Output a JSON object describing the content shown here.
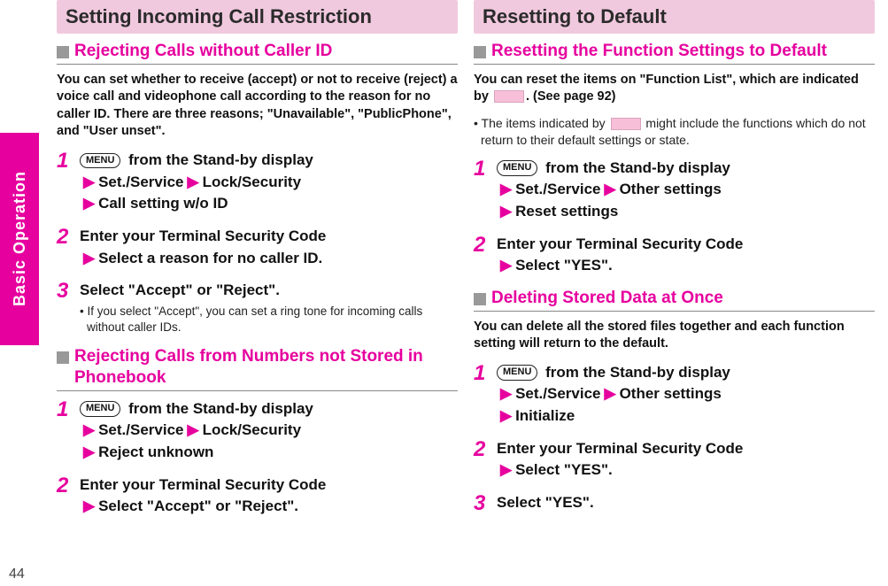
{
  "page": {
    "number": "44",
    "side_tab": "Basic Operation"
  },
  "left": {
    "section_title": "Setting Incoming Call Restriction",
    "sub1": {
      "title": "Rejecting Calls without Caller ID",
      "intro": "You can set whether to receive (accept) or not to receive (reject) a voice call and videophone call according to the reason for no caller ID. There are three reasons; \"Unavailable\", \"PublicPhone\", and \"User unset\".",
      "steps": [
        {
          "n": "1",
          "menu": "MENU",
          "after_menu": " from the Stand-by display",
          "lines": [
            "Set./Service",
            "Lock/Security",
            "Call setting w/o ID"
          ]
        },
        {
          "n": "2",
          "plain": "Enter your Terminal Security Code",
          "lines": [
            "Select a reason for no caller ID."
          ]
        },
        {
          "n": "3",
          "plain": "Select \"Accept\" or \"Reject\".",
          "note": "If you select \"Accept\", you can set a ring tone for incoming calls without caller IDs."
        }
      ]
    },
    "sub2": {
      "title": "Rejecting Calls from Numbers not Stored in Phonebook",
      "steps": [
        {
          "n": "1",
          "menu": "MENU",
          "after_menu": " from the Stand-by display",
          "lines": [
            "Set./Service",
            "Lock/Security",
            "Reject unknown"
          ]
        },
        {
          "n": "2",
          "plain": "Enter your Terminal Security Code",
          "lines": [
            "Select \"Accept\" or \"Reject\"."
          ]
        }
      ]
    }
  },
  "right": {
    "section_title": "Resetting to Default",
    "sub1": {
      "title": "Resetting the Function Settings to Default",
      "intro_pre": "You can reset the items on \"Function List\", which are indicated by ",
      "intro_post": ". (See page 92)",
      "note_pre": "The items indicated by ",
      "note_post": " might include the functions which do not return to their default settings or state.",
      "steps": [
        {
          "n": "1",
          "menu": "MENU",
          "after_menu": " from the Stand-by display",
          "lines": [
            "Set./Service",
            "Other settings",
            "Reset settings"
          ]
        },
        {
          "n": "2",
          "plain": "Enter your Terminal Security Code",
          "lines": [
            "Select \"YES\"."
          ]
        }
      ]
    },
    "sub2": {
      "title": "Deleting Stored Data at Once",
      "intro": "You can delete all the stored files together and each function setting will return to the default.",
      "steps": [
        {
          "n": "1",
          "menu": "MENU",
          "after_menu": " from the Stand-by display",
          "lines": [
            "Set./Service",
            "Other settings",
            "Initialize"
          ]
        },
        {
          "n": "2",
          "plain": "Enter your Terminal Security Code",
          "lines": [
            "Select \"YES\"."
          ]
        },
        {
          "n": "3",
          "plain": "Select \"YES\"."
        }
      ]
    }
  }
}
